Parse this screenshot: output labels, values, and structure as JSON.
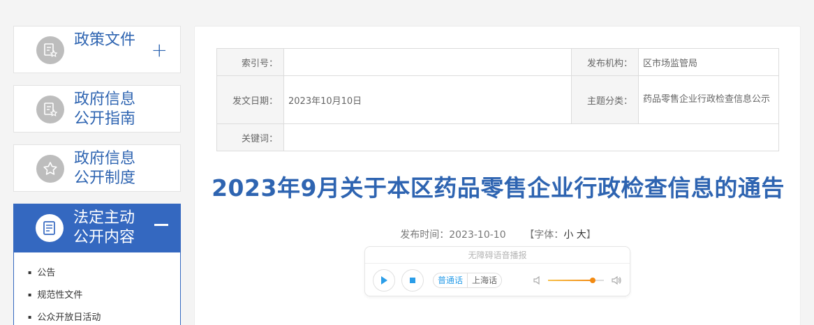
{
  "sidebar": {
    "items": [
      {
        "label": "政策文件",
        "toggle": "+",
        "icon": "document-star-icon"
      },
      {
        "label": "政府信息\n公开指南",
        "icon": "document-star-icon"
      },
      {
        "label": "政府信息\n公开制度",
        "icon": "star-icon"
      },
      {
        "label": "法定主动\n公开内容",
        "toggle": "−",
        "icon": "list-document-icon",
        "active": true
      }
    ],
    "sub_items": [
      "公告",
      "规范性文件",
      "公众开放日活动"
    ]
  },
  "meta": {
    "index_key": "索引号：",
    "index_val": "",
    "org_key": "发布机构：",
    "org_val": "区市场监管局",
    "date_key": "发文日期：",
    "date_val": "2023年10月10日",
    "topic_key": "主题分类：",
    "topic_val": "药品零售企业行政检查信息公示",
    "keyword_key": "关键词：",
    "keyword_val": ""
  },
  "article": {
    "title": "2023年9月关于本区药品零售企业行政检查信息的通告",
    "publish_label": "发布时间：2023-10-10",
    "font_prefix": "【字体：",
    "font_small": "小",
    "font_large": "大",
    "font_suffix": "】"
  },
  "player": {
    "caption": "无障碍语音播报",
    "lang_putonghua": "普通话",
    "lang_shanghai": "上海话",
    "volume": 0.8
  },
  "colors": {
    "brand_blue": "#2e64b1",
    "active_bg": "#3468c0",
    "player_accent": "#2a9de8",
    "volume_orange": "#f28a12"
  }
}
